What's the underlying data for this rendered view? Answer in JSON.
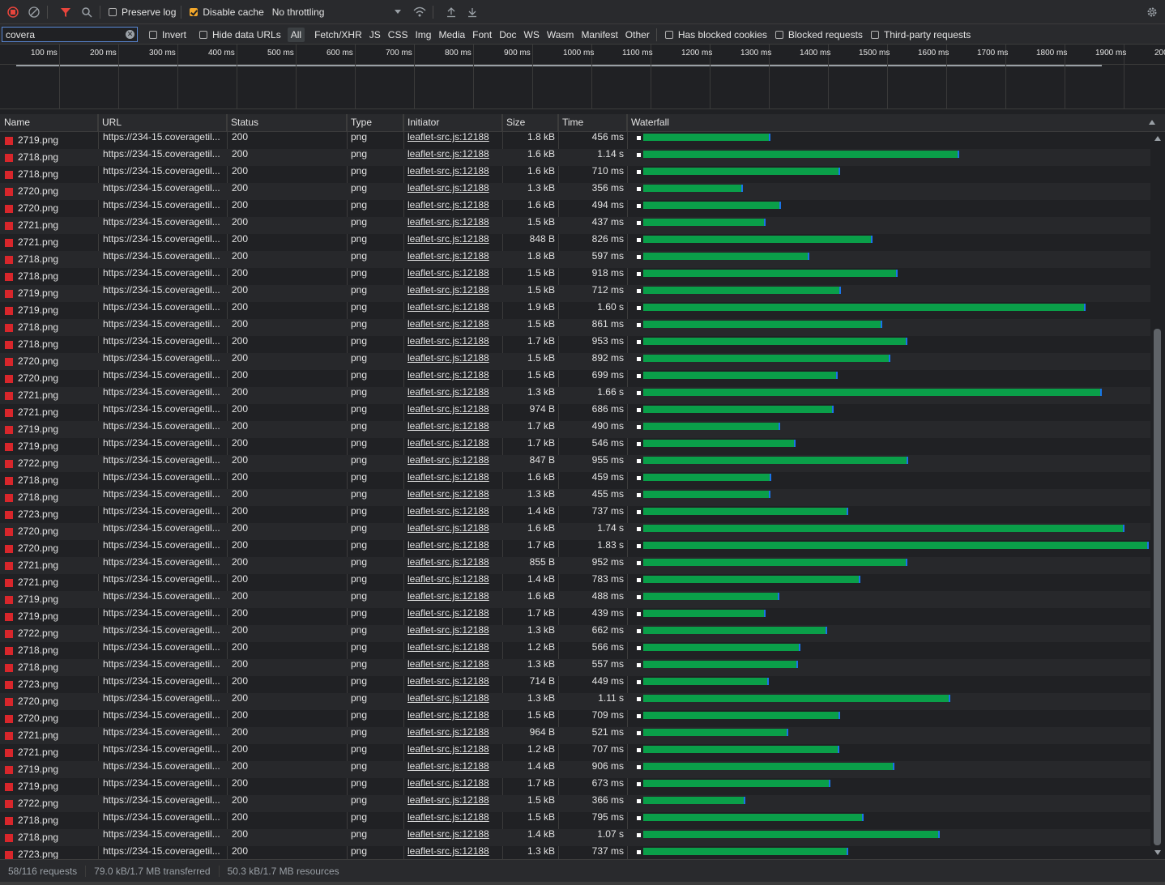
{
  "toolbar": {
    "preserve_log": "Preserve log",
    "disable_cache": "Disable cache",
    "throttling": "No throttling"
  },
  "filter": {
    "value": "covera",
    "invert": "Invert",
    "hide_data_urls": "Hide data URLs",
    "types": [
      "All",
      "Fetch/XHR",
      "JS",
      "CSS",
      "Img",
      "Media",
      "Font",
      "Doc",
      "WS",
      "Wasm",
      "Manifest",
      "Other"
    ],
    "has_blocked_cookies": "Has blocked cookies",
    "blocked_requests": "Blocked requests",
    "third_party": "Third-party requests"
  },
  "overview": {
    "ticks": [
      "100 ms",
      "200 ms",
      "300 ms",
      "400 ms",
      "500 ms",
      "600 ms",
      "700 ms",
      "800 ms",
      "900 ms",
      "1000 ms",
      "1100 ms",
      "1200 ms",
      "1300 ms",
      "1400 ms",
      "1500 ms",
      "1600 ms",
      "1700 ms",
      "1800 ms",
      "1900 ms",
      "200"
    ]
  },
  "columns": {
    "name": "Name",
    "url": "URL",
    "status": "Status",
    "type": "Type",
    "initiator": "Initiator",
    "size": "Size",
    "time": "Time",
    "waterfall": "Waterfall"
  },
  "row_defaults": {
    "url": "https://234-15.coveragetil...",
    "status": "200",
    "type": "png",
    "initiator": "leaflet-src.js:12188"
  },
  "rows": [
    {
      "name": "2719.png",
      "size": "1.8 kB",
      "time": "456 ms",
      "duration_ms": 456
    },
    {
      "name": "2718.png",
      "size": "1.6 kB",
      "time": "1.14 s",
      "duration_ms": 1140
    },
    {
      "name": "2718.png",
      "size": "1.6 kB",
      "time": "710 ms",
      "duration_ms": 710
    },
    {
      "name": "2720.png",
      "size": "1.3 kB",
      "time": "356 ms",
      "duration_ms": 356
    },
    {
      "name": "2720.png",
      "size": "1.6 kB",
      "time": "494 ms",
      "duration_ms": 494
    },
    {
      "name": "2721.png",
      "size": "1.5 kB",
      "time": "437 ms",
      "duration_ms": 437
    },
    {
      "name": "2721.png",
      "size": "848 B",
      "time": "826 ms",
      "duration_ms": 826
    },
    {
      "name": "2718.png",
      "size": "1.8 kB",
      "time": "597 ms",
      "duration_ms": 597
    },
    {
      "name": "2718.png",
      "size": "1.5 kB",
      "time": "918 ms",
      "duration_ms": 918
    },
    {
      "name": "2719.png",
      "size": "1.5 kB",
      "time": "712 ms",
      "duration_ms": 712
    },
    {
      "name": "2719.png",
      "size": "1.9 kB",
      "time": "1.60 s",
      "duration_ms": 1600
    },
    {
      "name": "2718.png",
      "size": "1.5 kB",
      "time": "861 ms",
      "duration_ms": 861
    },
    {
      "name": "2718.png",
      "size": "1.7 kB",
      "time": "953 ms",
      "duration_ms": 953
    },
    {
      "name": "2720.png",
      "size": "1.5 kB",
      "time": "892 ms",
      "duration_ms": 892
    },
    {
      "name": "2720.png",
      "size": "1.5 kB",
      "time": "699 ms",
      "duration_ms": 699
    },
    {
      "name": "2721.png",
      "size": "1.3 kB",
      "time": "1.66 s",
      "duration_ms": 1660
    },
    {
      "name": "2721.png",
      "size": "974 B",
      "time": "686 ms",
      "duration_ms": 686
    },
    {
      "name": "2719.png",
      "size": "1.7 kB",
      "time": "490 ms",
      "duration_ms": 490
    },
    {
      "name": "2719.png",
      "size": "1.7 kB",
      "time": "546 ms",
      "duration_ms": 546
    },
    {
      "name": "2722.png",
      "size": "847 B",
      "time": "955 ms",
      "duration_ms": 955
    },
    {
      "name": "2718.png",
      "size": "1.6 kB",
      "time": "459 ms",
      "duration_ms": 459
    },
    {
      "name": "2718.png",
      "size": "1.3 kB",
      "time": "455 ms",
      "duration_ms": 455
    },
    {
      "name": "2723.png",
      "size": "1.4 kB",
      "time": "737 ms",
      "duration_ms": 737
    },
    {
      "name": "2720.png",
      "size": "1.6 kB",
      "time": "1.74 s",
      "duration_ms": 1740
    },
    {
      "name": "2720.png",
      "size": "1.7 kB",
      "time": "1.83 s",
      "duration_ms": 1830
    },
    {
      "name": "2721.png",
      "size": "855 B",
      "time": "952 ms",
      "duration_ms": 952
    },
    {
      "name": "2721.png",
      "size": "1.4 kB",
      "time": "783 ms",
      "duration_ms": 783
    },
    {
      "name": "2719.png",
      "size": "1.6 kB",
      "time": "488 ms",
      "duration_ms": 488
    },
    {
      "name": "2719.png",
      "size": "1.7 kB",
      "time": "439 ms",
      "duration_ms": 439
    },
    {
      "name": "2722.png",
      "size": "1.3 kB",
      "time": "662 ms",
      "duration_ms": 662
    },
    {
      "name": "2718.png",
      "size": "1.2 kB",
      "time": "566 ms",
      "duration_ms": 566
    },
    {
      "name": "2718.png",
      "size": "1.3 kB",
      "time": "557 ms",
      "duration_ms": 557
    },
    {
      "name": "2723.png",
      "size": "714 B",
      "time": "449 ms",
      "duration_ms": 449
    },
    {
      "name": "2720.png",
      "size": "1.3 kB",
      "time": "1.11 s",
      "duration_ms": 1110
    },
    {
      "name": "2720.png",
      "size": "1.5 kB",
      "time": "709 ms",
      "duration_ms": 709
    },
    {
      "name": "2721.png",
      "size": "964 B",
      "time": "521 ms",
      "duration_ms": 521
    },
    {
      "name": "2721.png",
      "size": "1.2 kB",
      "time": "707 ms",
      "duration_ms": 707
    },
    {
      "name": "2719.png",
      "size": "1.4 kB",
      "time": "906 ms",
      "duration_ms": 906
    },
    {
      "name": "2719.png",
      "size": "1.7 kB",
      "time": "673 ms",
      "duration_ms": 673
    },
    {
      "name": "2722.png",
      "size": "1.5 kB",
      "time": "366 ms",
      "duration_ms": 366
    },
    {
      "name": "2718.png",
      "size": "1.5 kB",
      "time": "795 ms",
      "duration_ms": 795
    },
    {
      "name": "2718.png",
      "size": "1.4 kB",
      "time": "1.07 s",
      "duration_ms": 1070
    },
    {
      "name": "2723.png",
      "size": "1.3 kB",
      "time": "737 ms",
      "duration_ms": 737
    }
  ],
  "statusbar": {
    "requests": "58/116 requests",
    "transferred": "79.0 kB/1.7 MB transferred",
    "resources": "50.3 kB/1.7 MB resources"
  },
  "colors": {
    "bar": "#0a9f49",
    "bar_end": "#1a73e8",
    "accent": "#f2a72b",
    "record": "#e8453c"
  }
}
